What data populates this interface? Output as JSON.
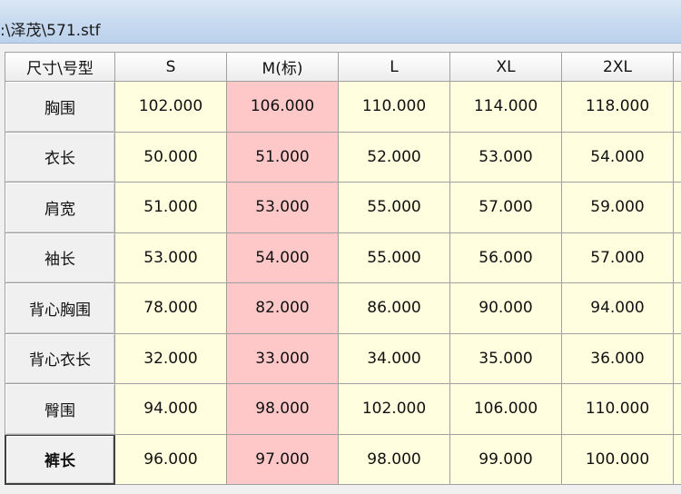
{
  "window": {
    "title": ":\\泽茂\\571.stf"
  },
  "colors": {
    "cell_background": "#ffffe0",
    "standard_size_column": "#ffc8c8",
    "titlebar": "#c6d9ef"
  },
  "table": {
    "corner_header": "尺寸\\号型",
    "columns": [
      "S",
      "M(标)",
      "L",
      "XL",
      "2XL"
    ],
    "standard_column_index": 1,
    "selected_row_index": 7,
    "rows": [
      {
        "label": "胸围",
        "values": [
          "102.000",
          "106.000",
          "110.000",
          "114.000",
          "118.000"
        ]
      },
      {
        "label": "衣长",
        "values": [
          "50.000",
          "51.000",
          "52.000",
          "53.000",
          "54.000"
        ]
      },
      {
        "label": "肩宽",
        "values": [
          "51.000",
          "53.000",
          "55.000",
          "57.000",
          "59.000"
        ]
      },
      {
        "label": "袖长",
        "values": [
          "53.000",
          "54.000",
          "55.000",
          "56.000",
          "57.000"
        ]
      },
      {
        "label": "背心胸围",
        "values": [
          "78.000",
          "82.000",
          "86.000",
          "90.000",
          "94.000"
        ]
      },
      {
        "label": "背心衣长",
        "values": [
          "32.000",
          "33.000",
          "34.000",
          "35.000",
          "36.000"
        ]
      },
      {
        "label": "臀围",
        "values": [
          "94.000",
          "98.000",
          "102.000",
          "106.000",
          "110.000"
        ]
      },
      {
        "label": "裤长",
        "values": [
          "96.000",
          "97.000",
          "98.000",
          "99.000",
          "100.000"
        ]
      }
    ]
  }
}
